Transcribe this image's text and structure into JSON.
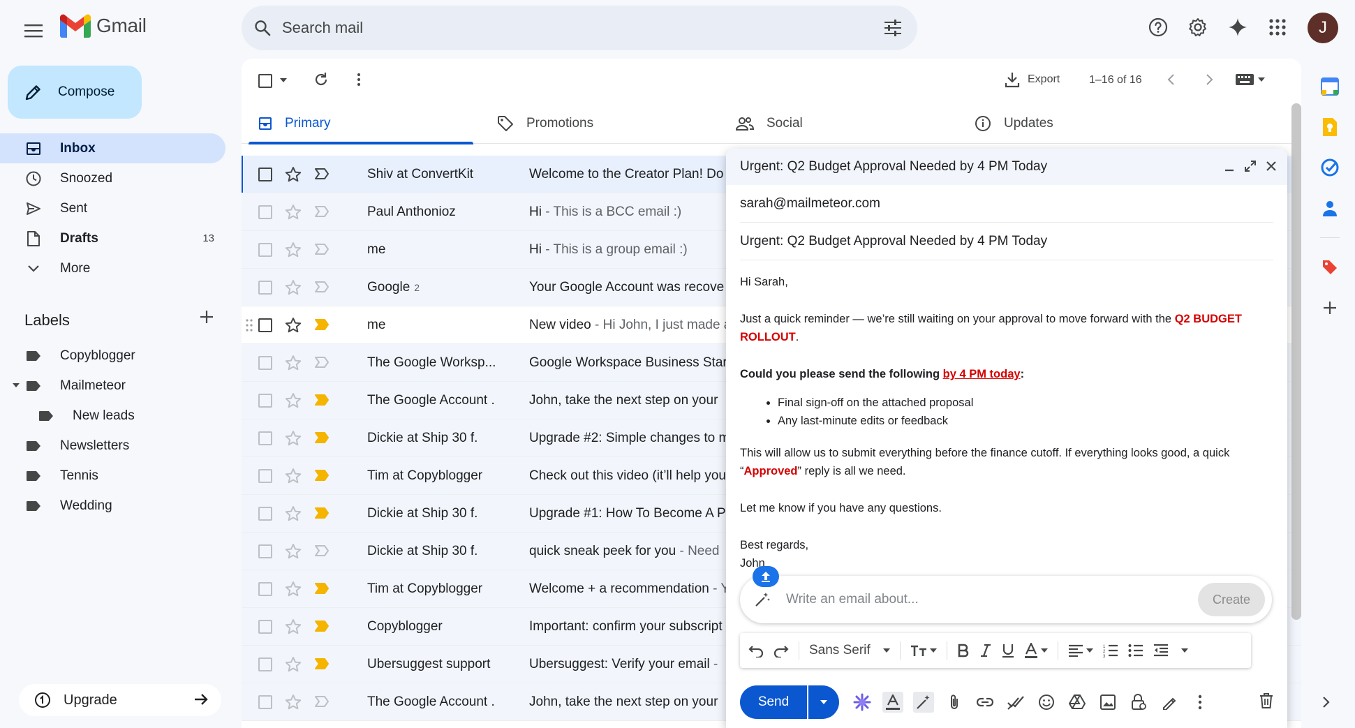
{
  "app": {
    "name": "Gmail"
  },
  "search": {
    "placeholder": "Search mail"
  },
  "user": {
    "avatar_letter": "J"
  },
  "compose_button": {
    "label": "Compose"
  },
  "nav": [
    {
      "label": "Inbox",
      "icon": "inbox-icon",
      "active": true,
      "count": ""
    },
    {
      "label": "Snoozed",
      "icon": "clock-icon",
      "active": false,
      "count": ""
    },
    {
      "label": "Sent",
      "icon": "send-icon",
      "active": false,
      "count": ""
    },
    {
      "label": "Drafts",
      "icon": "draft-icon",
      "active": false,
      "count": "13"
    },
    {
      "label": "More",
      "icon": "chevron-down-icon",
      "active": false,
      "count": ""
    }
  ],
  "labels": {
    "heading": "Labels",
    "items": [
      {
        "label": "Copyblogger"
      },
      {
        "label": "Mailmeteor"
      },
      {
        "label": "New leads"
      },
      {
        "label": "Newsletters"
      },
      {
        "label": "Tennis"
      },
      {
        "label": "Wedding"
      }
    ]
  },
  "upgrade": {
    "label": "Upgrade"
  },
  "toolbar": {
    "export_label": "Export",
    "page_count": "1–16 of 16"
  },
  "tabs": [
    {
      "label": "Primary"
    },
    {
      "label": "Promotions"
    },
    {
      "label": "Social"
    },
    {
      "label": "Updates"
    }
  ],
  "emails": [
    {
      "sender": "Shiv at ConvertKit",
      "count": "",
      "subject": "Welcome to the Creator Plan! Do",
      "snippet": ""
    },
    {
      "sender": "Paul Anthonioz",
      "count": "",
      "subject": "Hi",
      "snippet": " - This is a BCC email :)"
    },
    {
      "sender": "me",
      "count": "",
      "subject": "Hi",
      "snippet": " - This is a group email :)"
    },
    {
      "sender": "Google",
      "count": "2",
      "subject": "Your Google Account was recove",
      "snippet": ""
    },
    {
      "sender": "me",
      "count": "",
      "subject": "New video",
      "snippet": " - Hi John, I just made a"
    },
    {
      "sender": "The Google Worksp...",
      "count": "",
      "subject": "Google Workspace Business Star",
      "snippet": ""
    },
    {
      "sender": "The Google Account .",
      "count": "",
      "subject": "John, take the next step on your",
      "snippet": ""
    },
    {
      "sender": "Dickie at Ship 30 f.",
      "count": "",
      "subject": "Upgrade #2: Simple changes to m",
      "snippet": ""
    },
    {
      "sender": "Tim at Copyblogger",
      "count": "",
      "subject": "Check out this video (it’ll help you",
      "snippet": ""
    },
    {
      "sender": "Dickie at Ship 30 f.",
      "count": "",
      "subject": "Upgrade #1: How To Become A P",
      "snippet": ""
    },
    {
      "sender": "Dickie at Ship 30 f.",
      "count": "",
      "subject": "quick sneak peek for you",
      "snippet": " - Need"
    },
    {
      "sender": "Tim at Copyblogger",
      "count": "",
      "subject": "Welcome + a recommendation",
      "snippet": " - Y"
    },
    {
      "sender": "Copyblogger",
      "count": "",
      "subject": "Important: confirm your subscript",
      "snippet": ""
    },
    {
      "sender": "Ubersuggest support",
      "count": "",
      "subject": "Ubersuggest: Verify your email",
      "snippet": " - "
    },
    {
      "sender": "The Google Account .",
      "count": "",
      "subject": "John, take the next step on your",
      "snippet": ""
    }
  ],
  "compose_window": {
    "title": "Urgent: Q2 Budget Approval Needed by 4 PM Today",
    "to": "sarah@mailmeteor.com",
    "subject": "Urgent: Q2 Budget Approval Needed by 4 PM Today",
    "greeting": "Hi Sarah,",
    "p1_a": "Just a quick reminder — we’re still waiting on your approval to move forward with the ",
    "p1_red": "Q2 BUDGET ROLLOUT",
    "p1_b": ".",
    "p2_a": "Could you please send the following ",
    "p2_link": "by 4 PM today",
    "p2_b": ":",
    "bullets": [
      "Final sign-off on the attached proposal",
      "Any last-minute edits or feedback"
    ],
    "p3_a": "This will allow us to submit everything before the finance cutoff. If everything looks good, a quick “",
    "p3_red": "Approved",
    "p3_b": "” reply is all we need.",
    "p4": "Let me know if you have any questions.",
    "signoff": "Best regards,",
    "signature": "John",
    "ai_placeholder": "Write an email about...",
    "ai_create": "Create",
    "font_name": "Sans Serif",
    "send_label": "Send"
  },
  "colors": {
    "accent": "#0b57d0",
    "compose": "#c2e7ff",
    "active_nav": "#d3e3fd",
    "important_yellow": "#f4b400",
    "emphasis_red": "#d50000"
  }
}
